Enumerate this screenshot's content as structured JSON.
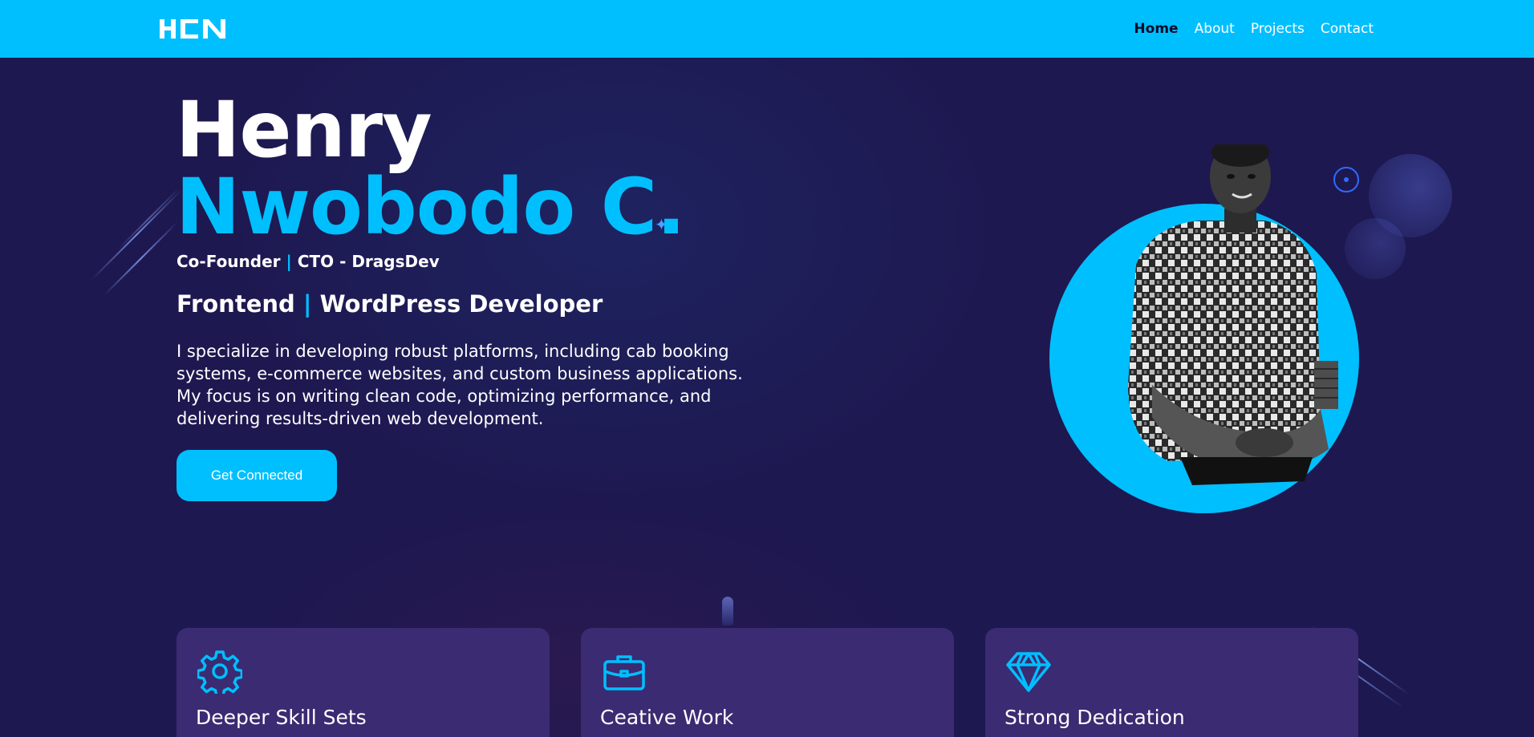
{
  "nav": {
    "logo": "HCN",
    "links": [
      {
        "label": "Home",
        "active": true
      },
      {
        "label": "About",
        "active": false
      },
      {
        "label": "Projects",
        "active": false
      },
      {
        "label": "Contact",
        "active": false
      }
    ]
  },
  "hero": {
    "first_name": "Henry",
    "last_name": "Nwobodo C.",
    "role_part1": "Co-Founder",
    "role_sep": "|",
    "role_part2": "CTO - DragsDev",
    "title_part1": "Frontend",
    "title_sep": "|",
    "title_part2": "WordPress Developer",
    "bio": "I specialize in developing robust platforms, including cab booking systems, e-commerce websites, and custom business applications. My focus is on writing clean code, optimizing performance, and delivering results-driven web development.",
    "cta_label": "Get Connected"
  },
  "cards": [
    {
      "icon": "gear-icon",
      "title": "Deeper Skill Sets"
    },
    {
      "icon": "briefcase-icon",
      "title": "Ceative Work"
    },
    {
      "icon": "diamond-icon",
      "title": "Strong Dedication"
    }
  ],
  "colors": {
    "accent": "#00bfff",
    "background": "#1e1850",
    "card": "#3b2b72",
    "nav_active": "#0b0b2a"
  }
}
